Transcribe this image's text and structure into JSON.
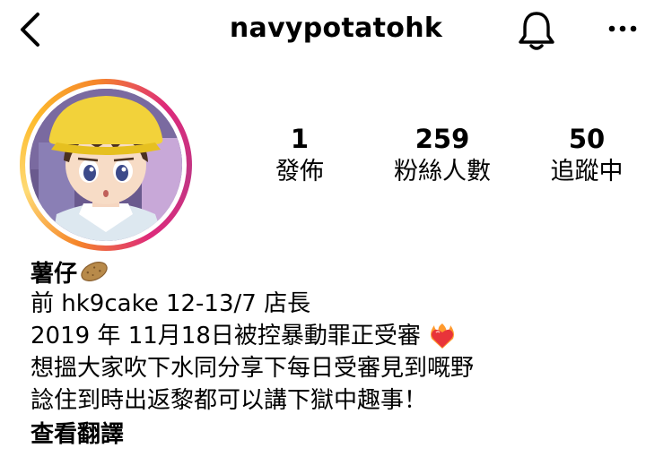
{
  "header": {
    "username": "navypotatohk",
    "back_icon": "chevron-left-icon",
    "notification_icon": "bell-icon",
    "more_icon": "more-horizontal-icon"
  },
  "stats": [
    {
      "value": "1",
      "label": "發佈"
    },
    {
      "value": "259",
      "label": "粉絲人數"
    },
    {
      "value": "50",
      "label": "追蹤中"
    }
  ],
  "bio": {
    "display_name": "薯仔",
    "name_icon": "potato-icon",
    "lines": [
      "前 hk9cake 12-13/7 店長",
      "2019 年 11月18日被控暴動罪正受審",
      "想搵大家吹下水同分享下每日受審見到嘅野",
      "諗住到時出返黎都可以講下獄中趣事！"
    ],
    "line2_icon": "heart-on-fire-icon",
    "translate_label": "查看翻譯"
  },
  "colors": {
    "ring_gradient": [
      "#f58529",
      "#feda75",
      "#dd2a7b",
      "#c13584"
    ],
    "text": "#000000",
    "background": "#ffffff"
  }
}
